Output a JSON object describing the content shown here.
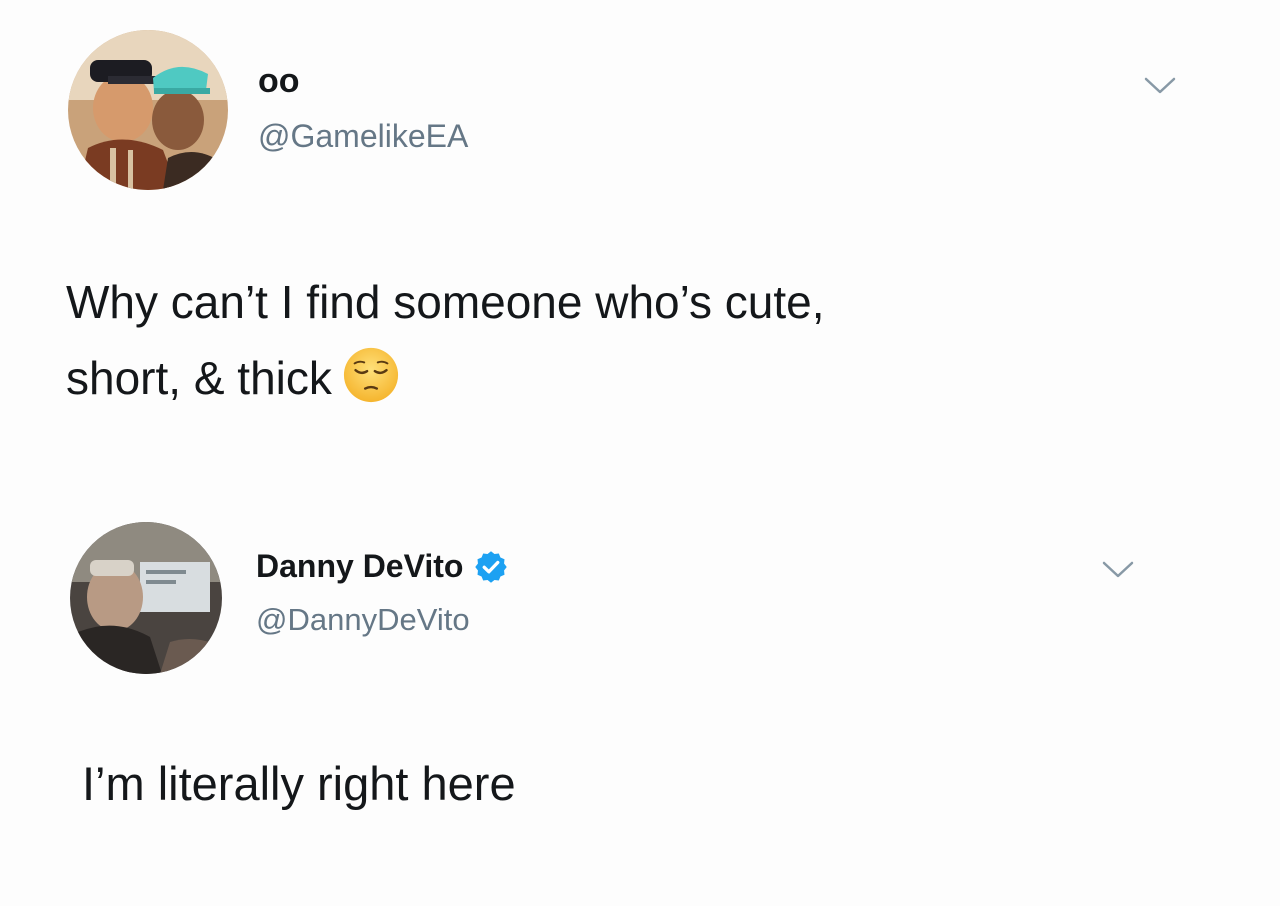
{
  "tweets": [
    {
      "display_name": "oo",
      "handle": "@GamelikeEA",
      "verified": false,
      "text_lines": [
        "Why can’t I find someone who’s cute,",
        "short, & thick"
      ],
      "emoji": "pensive-face-emoji",
      "menu_icon": "chevron-down-icon"
    },
    {
      "display_name": "Danny DeVito",
      "handle": "@DannyDeVito",
      "verified": true,
      "text_lines": [
        "I’m literally right here"
      ],
      "menu_icon": "chevron-down-icon"
    }
  ],
  "colors": {
    "text": "#14171a",
    "secondary_text": "#657786",
    "verified_blue": "#1da1f2",
    "background": "#ffffff"
  }
}
